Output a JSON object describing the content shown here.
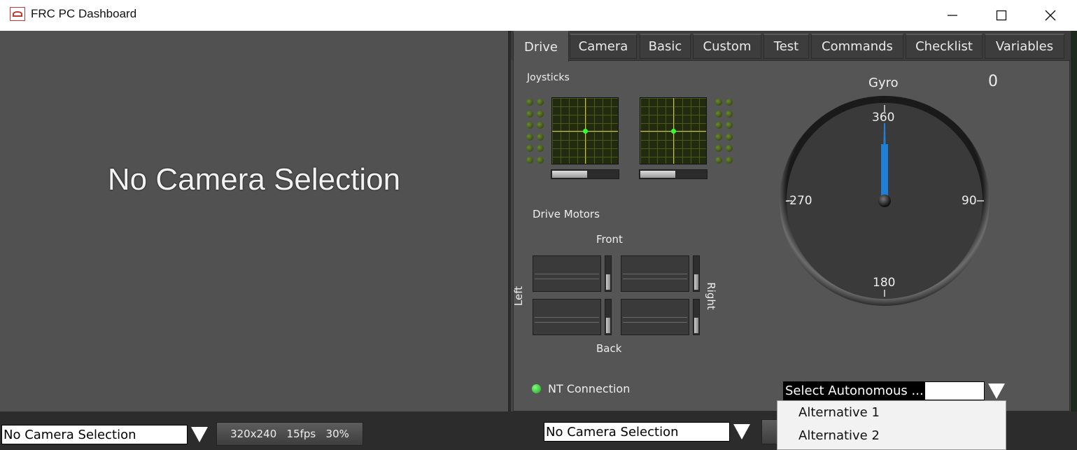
{
  "window": {
    "title": "FRC PC Dashboard",
    "controls": [
      "minimize-icon",
      "maximize-icon",
      "close-icon"
    ]
  },
  "camera_panel": {
    "message": "No Camera Selection"
  },
  "tabs": [
    {
      "label": "Drive",
      "active": true
    },
    {
      "label": "Camera",
      "active": false
    },
    {
      "label": "Basic",
      "active": false
    },
    {
      "label": "Custom",
      "active": false
    },
    {
      "label": "Test",
      "active": false
    },
    {
      "label": "Commands",
      "active": false
    },
    {
      "label": "Checklist",
      "active": false
    },
    {
      "label": "Variables",
      "active": false
    }
  ],
  "drive": {
    "joysticks_label": "Joysticks",
    "gyro": {
      "label": "Gyro",
      "value": "0",
      "ticks": {
        "top": "360",
        "left": "-270",
        "right": "90",
        "bottom": "180"
      },
      "needle_deg": 0,
      "needle_color": "#1f7fd6"
    },
    "drive_motors": {
      "label": "Drive Motors",
      "front": "Front",
      "back": "Back",
      "left": "Left",
      "right": "Right"
    },
    "nt_connection": {
      "label": "NT Connection",
      "led_color": "#33cc33"
    },
    "autonomous": {
      "selected": "Select Autonomous ...",
      "options": [
        "Alternative 1",
        "Alternative 2"
      ]
    }
  },
  "bottom_bar": {
    "left_camera_select": "No Camera Selection",
    "stream_info": "320x240   15fps   30%",
    "right_camera_select": "No Camera Selection"
  }
}
